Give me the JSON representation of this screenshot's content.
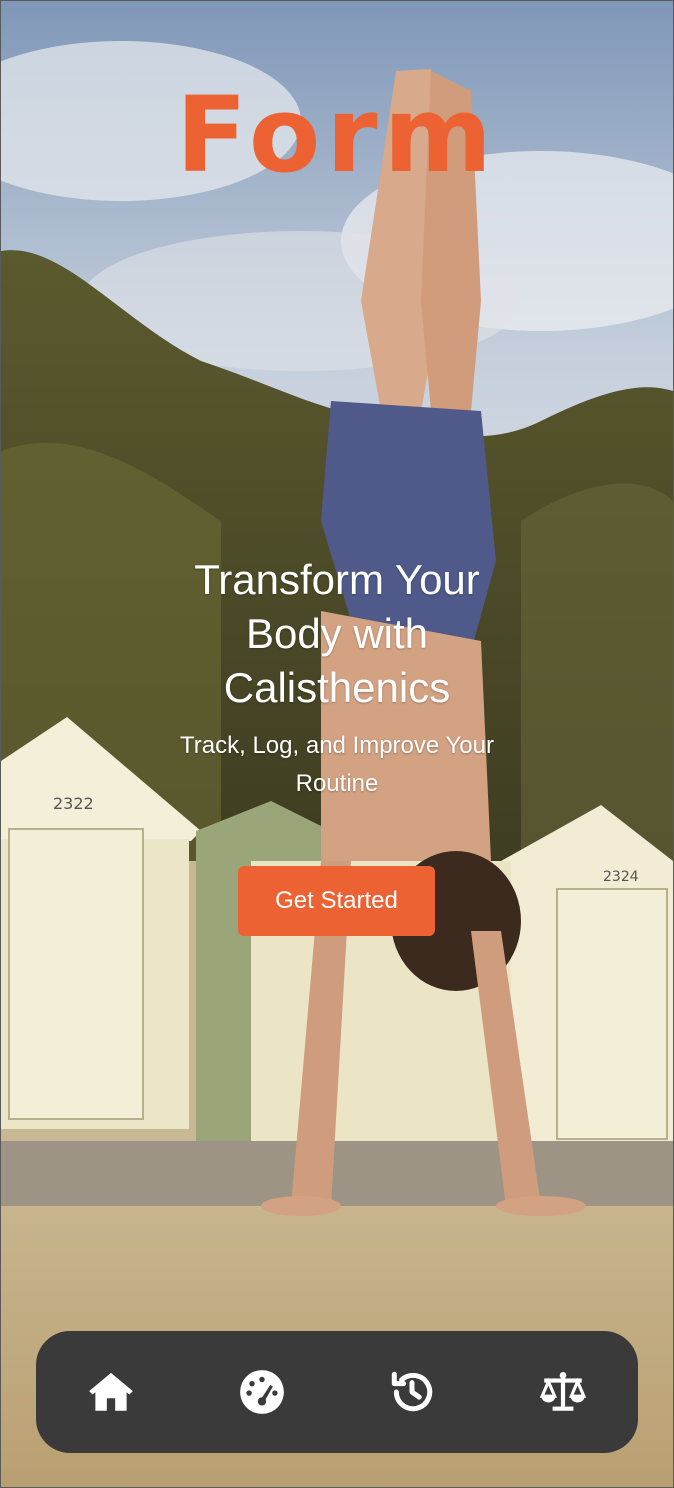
{
  "app": {
    "logo_text": "Form",
    "accent_color": "#ec6233"
  },
  "hero": {
    "headline": "Transform Your Body with Calisthenics",
    "subheadline": "Track, Log, and Improve Your Routine",
    "cta_label": "Get Started"
  },
  "background": {
    "description": "photo of person doing a handstand on a beach in front of beach huts"
  },
  "bottom_nav": {
    "background_color": "#3a3a3a",
    "items": [
      {
        "icon": "home-icon"
      },
      {
        "icon": "dashboard-icon"
      },
      {
        "icon": "history-icon"
      },
      {
        "icon": "scale-icon"
      }
    ]
  }
}
